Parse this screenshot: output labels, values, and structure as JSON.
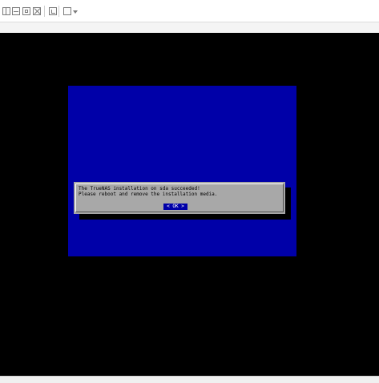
{
  "toolbar": {
    "buttons": [
      {
        "icon": "panel-icon"
      },
      {
        "icon": "minimize-icon"
      },
      {
        "icon": "fit-screen-icon"
      },
      {
        "icon": "close-icon"
      },
      {
        "icon": "console-icon"
      },
      {
        "icon": "view-icon"
      }
    ]
  },
  "colors": {
    "console_black": "#000000",
    "installer_blue": "#0000a8",
    "dialog_gray": "#a8a8a8"
  },
  "installer": {
    "message_line1": "The TrueNAS installation on sda succeeded!",
    "message_line2": "Please reboot and remove the installation media.",
    "ok_label": "< OK >"
  }
}
